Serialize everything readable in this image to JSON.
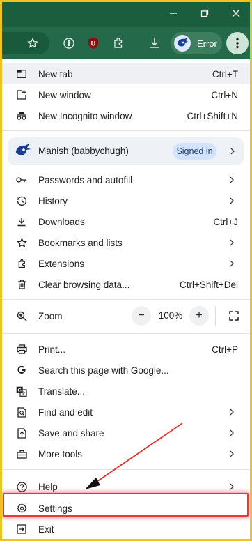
{
  "profile_button": {
    "label": "Error"
  },
  "menu": {
    "new_tab": {
      "label": "New tab",
      "shortcut": "Ctrl+T"
    },
    "new_window": {
      "label": "New window",
      "shortcut": "Ctrl+N"
    },
    "new_incognito": {
      "label": "New Incognito window",
      "shortcut": "Ctrl+Shift+N"
    },
    "profile": {
      "name": "Manish (babbychugh)",
      "status": "Signed in"
    },
    "passwords": {
      "label": "Passwords and autofill"
    },
    "history": {
      "label": "History"
    },
    "downloads": {
      "label": "Downloads",
      "shortcut": "Ctrl+J"
    },
    "bookmarks": {
      "label": "Bookmarks and lists"
    },
    "extensions": {
      "label": "Extensions"
    },
    "clear_data": {
      "label": "Clear browsing data...",
      "shortcut": "Ctrl+Shift+Del"
    },
    "zoom": {
      "label": "Zoom",
      "value": "100%",
      "minus": "−",
      "plus": "+"
    },
    "print": {
      "label": "Print...",
      "shortcut": "Ctrl+P"
    },
    "search_google": {
      "label": "Search this page with Google..."
    },
    "translate": {
      "label": "Translate..."
    },
    "find_edit": {
      "label": "Find and edit"
    },
    "save_share": {
      "label": "Save and share"
    },
    "more_tools": {
      "label": "More tools"
    },
    "help": {
      "label": "Help"
    },
    "settings": {
      "label": "Settings"
    },
    "exit": {
      "label": "Exit"
    }
  },
  "colors": {
    "frame": "#1a5e3e",
    "toolbar": "#23694a",
    "outer_border": "#f0c21a",
    "highlight": "#e5383b",
    "signed_in_badge": "#d3e3fd"
  },
  "icons": [
    "minimize-icon",
    "maximize-icon",
    "close-icon",
    "star-icon",
    "lighthouse-icon",
    "ublock-icon",
    "extensions-icon",
    "download-icon",
    "kebab-icon"
  ]
}
